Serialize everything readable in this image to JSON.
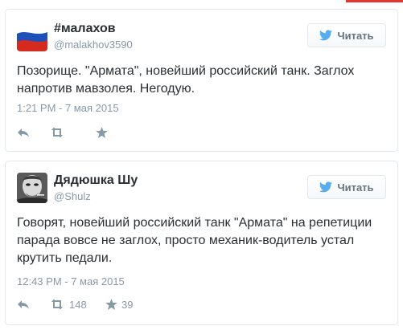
{
  "tweets": [
    {
      "name": "#малахов",
      "handle": "@malakhov3590",
      "follow_label": "Читать",
      "text": "Позорище. \"Армата\", новейший российский танк. Заглох напротив мавзолея. Негодую.",
      "timestamp": "1:21 PM - 7 мая 2015",
      "retweet_count": "",
      "favorite_count": ""
    },
    {
      "name": "Дядюшка Шу",
      "handle": "@Shulz",
      "follow_label": "Читать",
      "text": "Говорят, новейший российский танк \"Армата\" на репетиции парада вовсе не заглох, просто механик-водитель устал крутить педали.",
      "timestamp": "12:43 PM - 7 мая 2015",
      "retweet_count": "148",
      "favorite_count": "39"
    }
  ],
  "colors": {
    "accent": "#55acee",
    "muted": "#8899a6",
    "text": "#292f33",
    "border": "#e1e8ed",
    "flag_white": "#ffffff",
    "flag_blue": "#1f4fb8",
    "flag_red": "#d52b1e",
    "top_strip": "#e3342f"
  },
  "icons": {
    "follow": "twitter-bird-icon",
    "reply": "reply-icon",
    "retweet": "retweet-icon",
    "favorite": "star-icon"
  }
}
